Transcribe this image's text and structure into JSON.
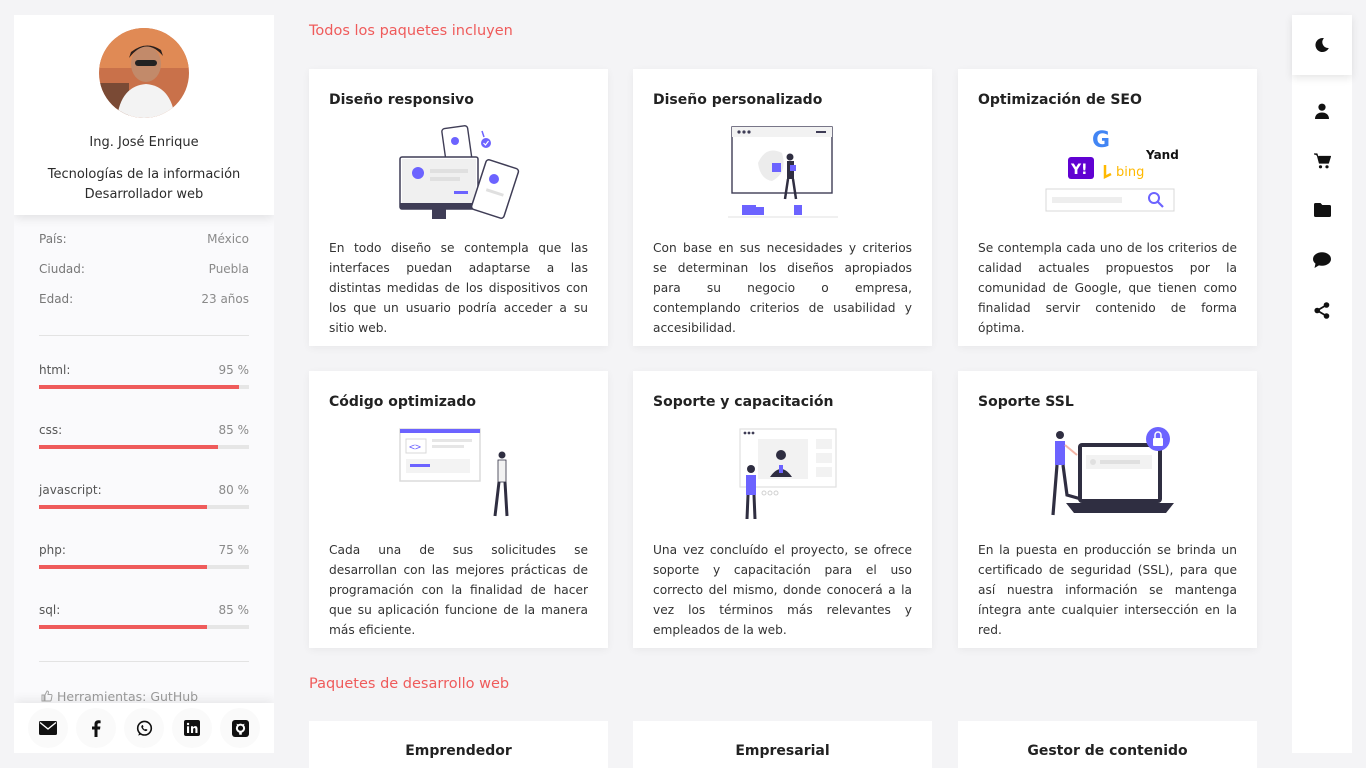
{
  "profile": {
    "name": "Ing. José Enrique",
    "role_line1": "Tecnologías de la información",
    "role_line2": "Desarrollador web"
  },
  "info": [
    {
      "label": "País:",
      "value": "México"
    },
    {
      "label": "Ciudad:",
      "value": "Puebla"
    },
    {
      "label": "Edad:",
      "value": "23 años"
    }
  ],
  "skills": [
    {
      "name": "html:",
      "pct_label": "95 %",
      "pct": 95
    },
    {
      "name": "css:",
      "pct_label": "85 %",
      "pct": 85
    },
    {
      "name": "javascript:",
      "pct_label": "80 %",
      "pct": 80
    },
    {
      "name": "php:",
      "pct_label": "75 %",
      "pct": 80
    },
    {
      "name": "sql:",
      "pct_label": "85 %",
      "pct": 80
    }
  ],
  "tools_label": "Herramientas: GutHub",
  "social": [
    "mail-icon",
    "facebook-icon",
    "whatsapp-icon",
    "linkedin-icon",
    "github-icon"
  ],
  "sections": {
    "included": "Todos los paquetes incluyen",
    "packages": "Paquetes de desarrollo web"
  },
  "features": [
    {
      "title": "Diseño responsivo",
      "text": "En todo diseño se contempla que las interfaces puedan adaptarse a las distintas medidas de los dispositivos con los que un usuario podría acceder a su sitio web."
    },
    {
      "title": "Diseño personalizado",
      "text": "Con base en sus necesidades y criterios se determinan los diseños apropiados para su negocio o empresa, contemplando criterios de usabilidad y accesibilidad."
    },
    {
      "title": "Optimización de SEO",
      "text": "Se contempla cada uno de los criterios de calidad actuales propuestos por la comunidad de Google, que tienen como finalidad servir contenido de forma óptima."
    },
    {
      "title": "Código optimizado",
      "text": "Cada una de sus solicitudes se desarrollan con las mejores prácticas de programación con la finalidad de hacer que su aplicación funcione de la manera más eficiente."
    },
    {
      "title": "Soporte y capacitación",
      "text": "Una vez concluído el proyecto, se ofrece soporte y capacitación para el uso correcto del mismo, donde conocerá a la vez los términos más relevantes y empleados de la web."
    },
    {
      "title": "Soporte SSL",
      "text": "En la puesta en producción se brinda un certificado de seguridad (SSL), para que así nuestra información se mantenga íntegra ante cualquier intersección en la red."
    }
  ],
  "seo_logos": {
    "google": "G",
    "yahoo": "Y!",
    "yandex": "Yandex",
    "bing": "bing"
  },
  "packages": [
    "Emprendedor",
    "Empresarial",
    "Gestor de contenido"
  ],
  "colors": {
    "accent": "#ef5b5b",
    "illustration": "#6c63ff"
  },
  "right_nav": [
    "moon-icon",
    "user-icon",
    "cart-icon",
    "folder-icon",
    "chat-icon",
    "share-icon"
  ]
}
